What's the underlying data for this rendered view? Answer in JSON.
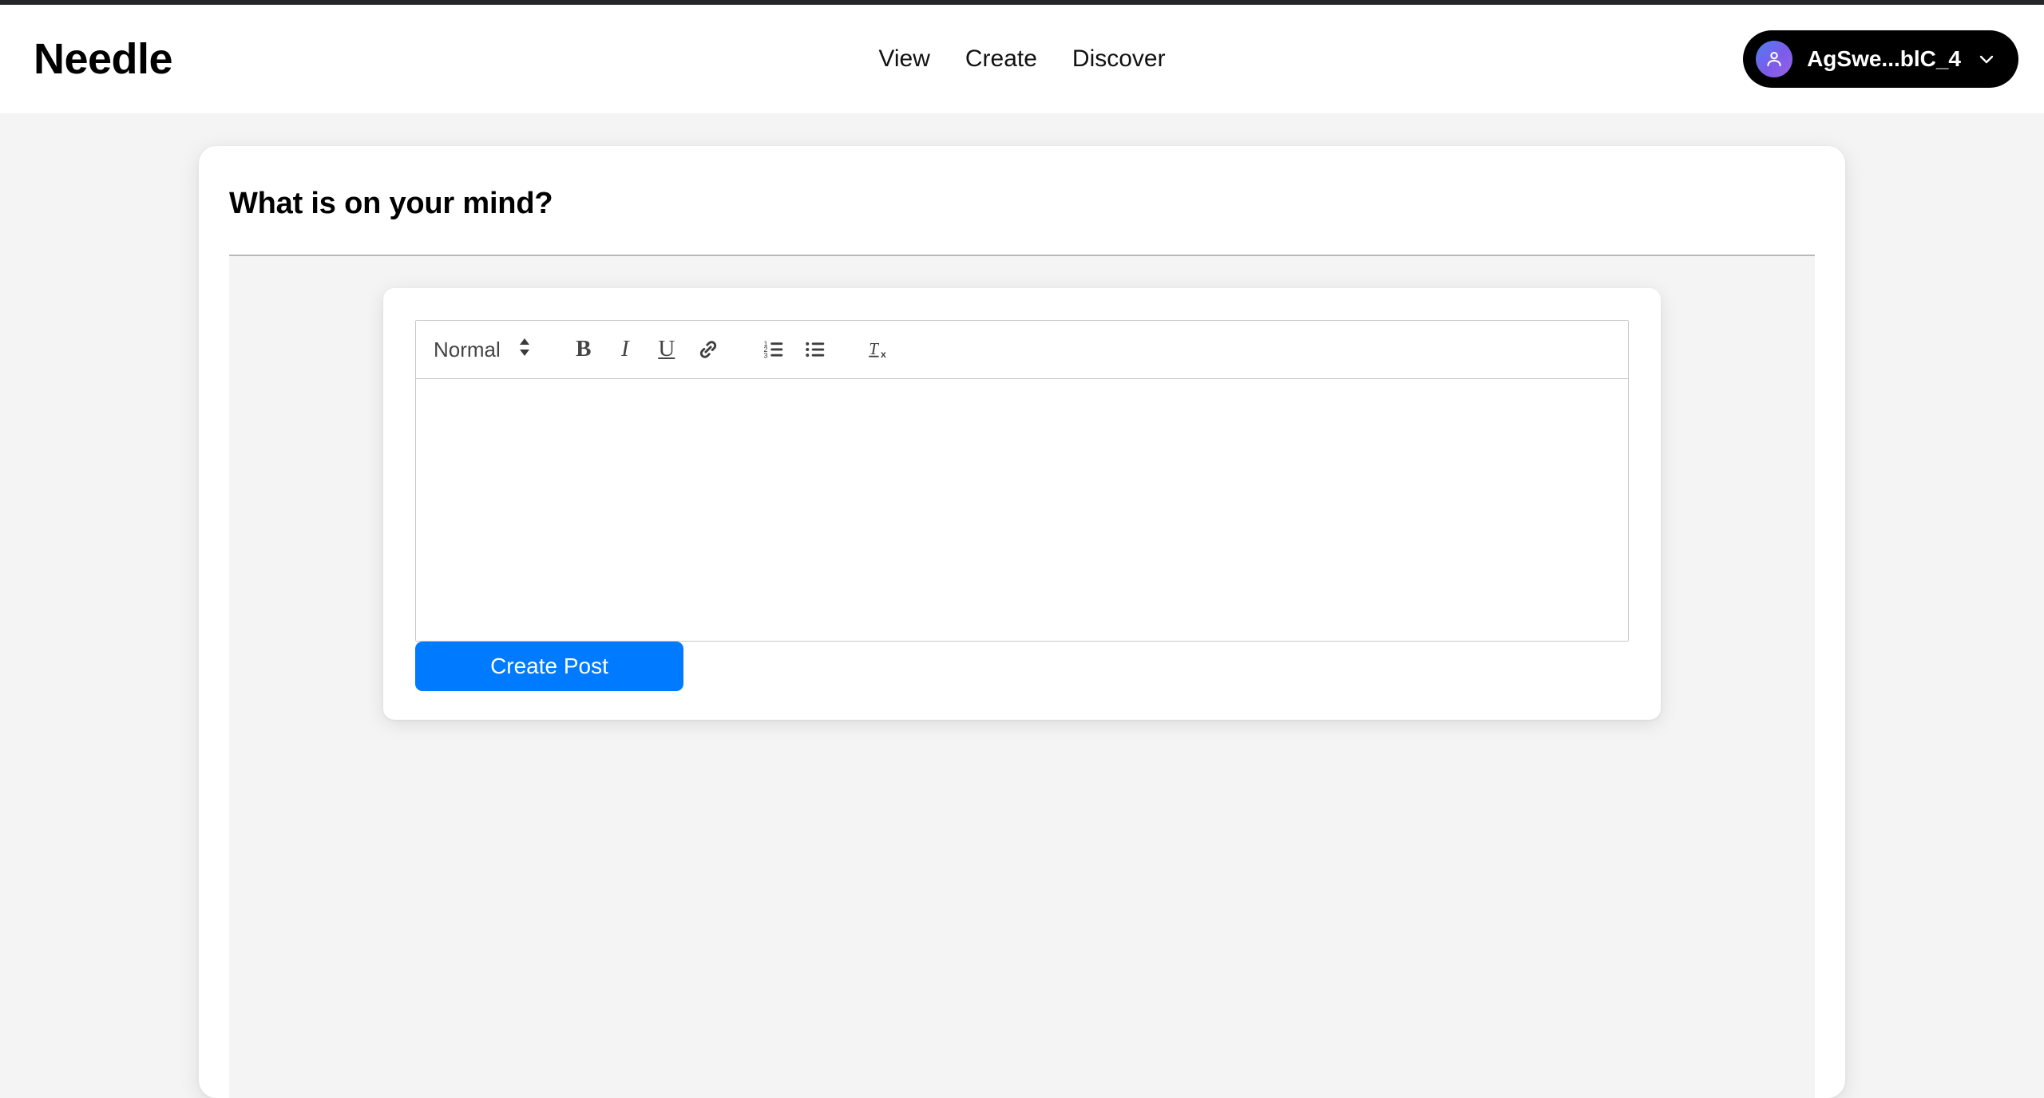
{
  "header": {
    "brand": "Needle",
    "nav": [
      {
        "label": "View",
        "name": "nav-link-view"
      },
      {
        "label": "Create",
        "name": "nav-link-create"
      },
      {
        "label": "Discover",
        "name": "nav-link-discover"
      }
    ],
    "user": {
      "name": "AgSwe...blC_4",
      "avatar_icon": "person-icon",
      "chevron_icon": "chevron-down-icon",
      "avatar_gradient_from": "#4f7ff0",
      "avatar_gradient_to": "#9a62e8",
      "pill_background": "#000000"
    }
  },
  "main": {
    "title": "What is on your mind?",
    "editor": {
      "toolbar": {
        "format_value": "Normal",
        "format_options": [
          "Normal"
        ],
        "stepper_icon": "up-down-chevron-icon",
        "buttons": [
          {
            "name": "bold-button",
            "label": "B",
            "icon": "bold-icon"
          },
          {
            "name": "italic-button",
            "label": "I",
            "icon": "italic-icon"
          },
          {
            "name": "underline-button",
            "label": "U",
            "icon": "underline-icon"
          },
          {
            "name": "link-button",
            "label": "",
            "icon": "link-icon"
          },
          {
            "name": "ordered-list-button",
            "label": "",
            "icon": "ordered-list-icon"
          },
          {
            "name": "bullet-list-button",
            "label": "",
            "icon": "bullet-list-icon"
          },
          {
            "name": "clear-formatting-button",
            "label": "",
            "icon": "clear-formatting-icon"
          }
        ]
      },
      "content": "",
      "placeholder": "",
      "submit_label": "Create Post",
      "submit_color": "#007bff"
    }
  },
  "colors": {
    "page_background": "#f4f4f4",
    "card_background": "#ffffff",
    "top_strip": "#24262a",
    "rule": "#b9b9b9",
    "border": "#c9c9c9",
    "accent": "#007bff"
  }
}
